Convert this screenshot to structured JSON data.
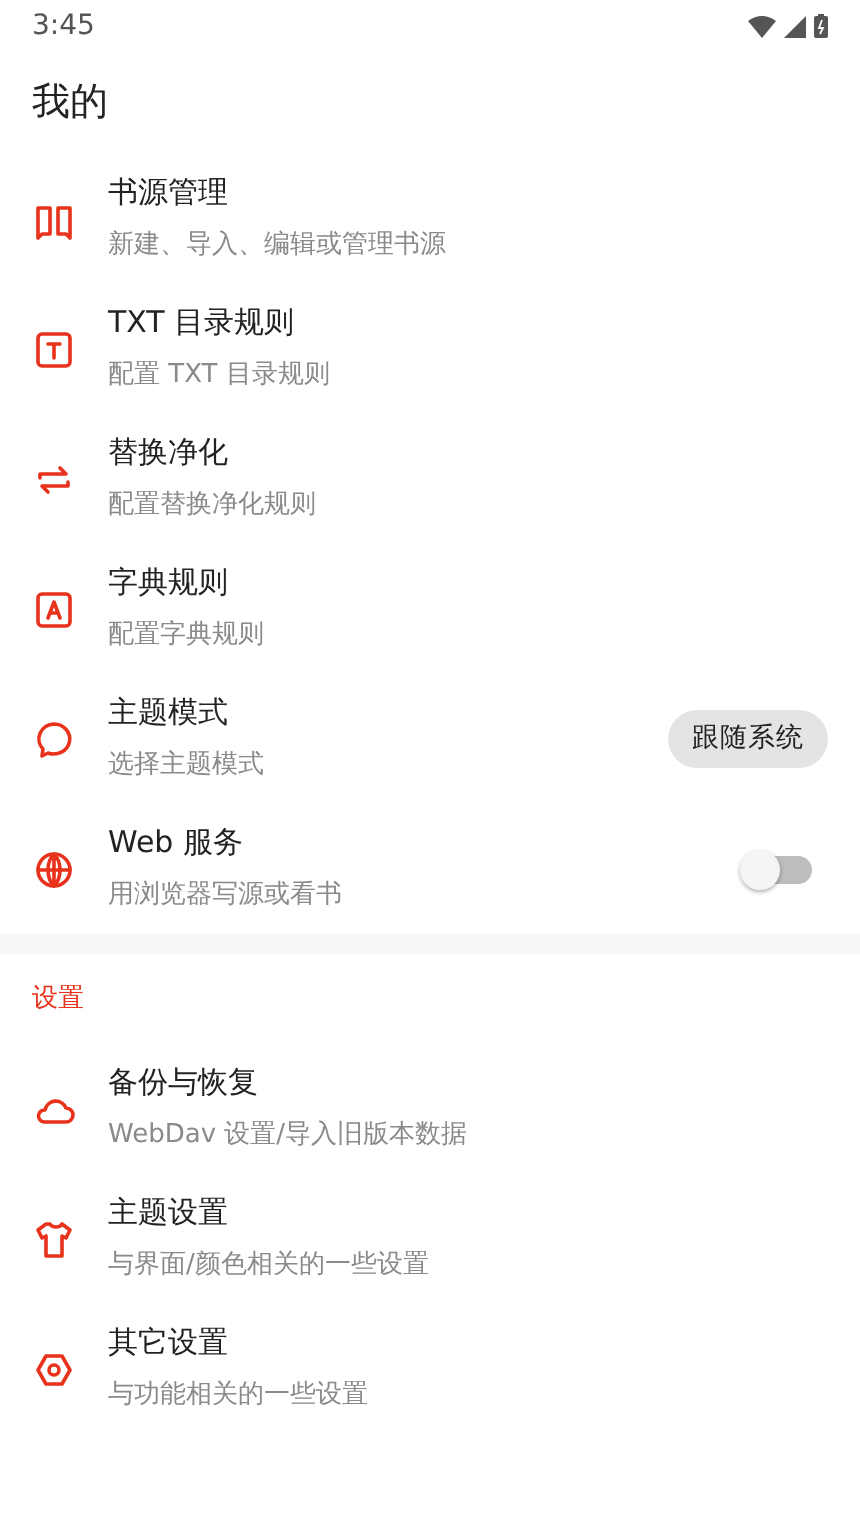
{
  "status_bar": {
    "time": "3:45"
  },
  "header": {
    "title": "我的"
  },
  "sections": [
    {
      "items": [
        {
          "title": "书源管理",
          "subtitle": "新建、导入、编辑或管理书源",
          "kind": "plain"
        },
        {
          "title": "TXT 目录规则",
          "subtitle": "配置 TXT 目录规则",
          "kind": "plain"
        },
        {
          "title": "替换净化",
          "subtitle": "配置替换净化规则",
          "kind": "plain"
        },
        {
          "title": "字典规则",
          "subtitle": "配置字典规则",
          "kind": "plain"
        },
        {
          "title": "主题模式",
          "subtitle": "选择主题模式",
          "kind": "chip",
          "value": "跟随系统"
        },
        {
          "title": "Web 服务",
          "subtitle": "用浏览器写源或看书",
          "kind": "switch",
          "on": false
        }
      ]
    },
    {
      "heading": "设置",
      "items": [
        {
          "title": "备份与恢复",
          "subtitle": "WebDav 设置/导入旧版本数据",
          "kind": "plain"
        },
        {
          "title": "主题设置",
          "subtitle": "与界面/颜色相关的一些设置",
          "kind": "plain"
        },
        {
          "title": "其它设置",
          "subtitle": "与功能相关的一些设置",
          "kind": "plain"
        }
      ]
    }
  ]
}
